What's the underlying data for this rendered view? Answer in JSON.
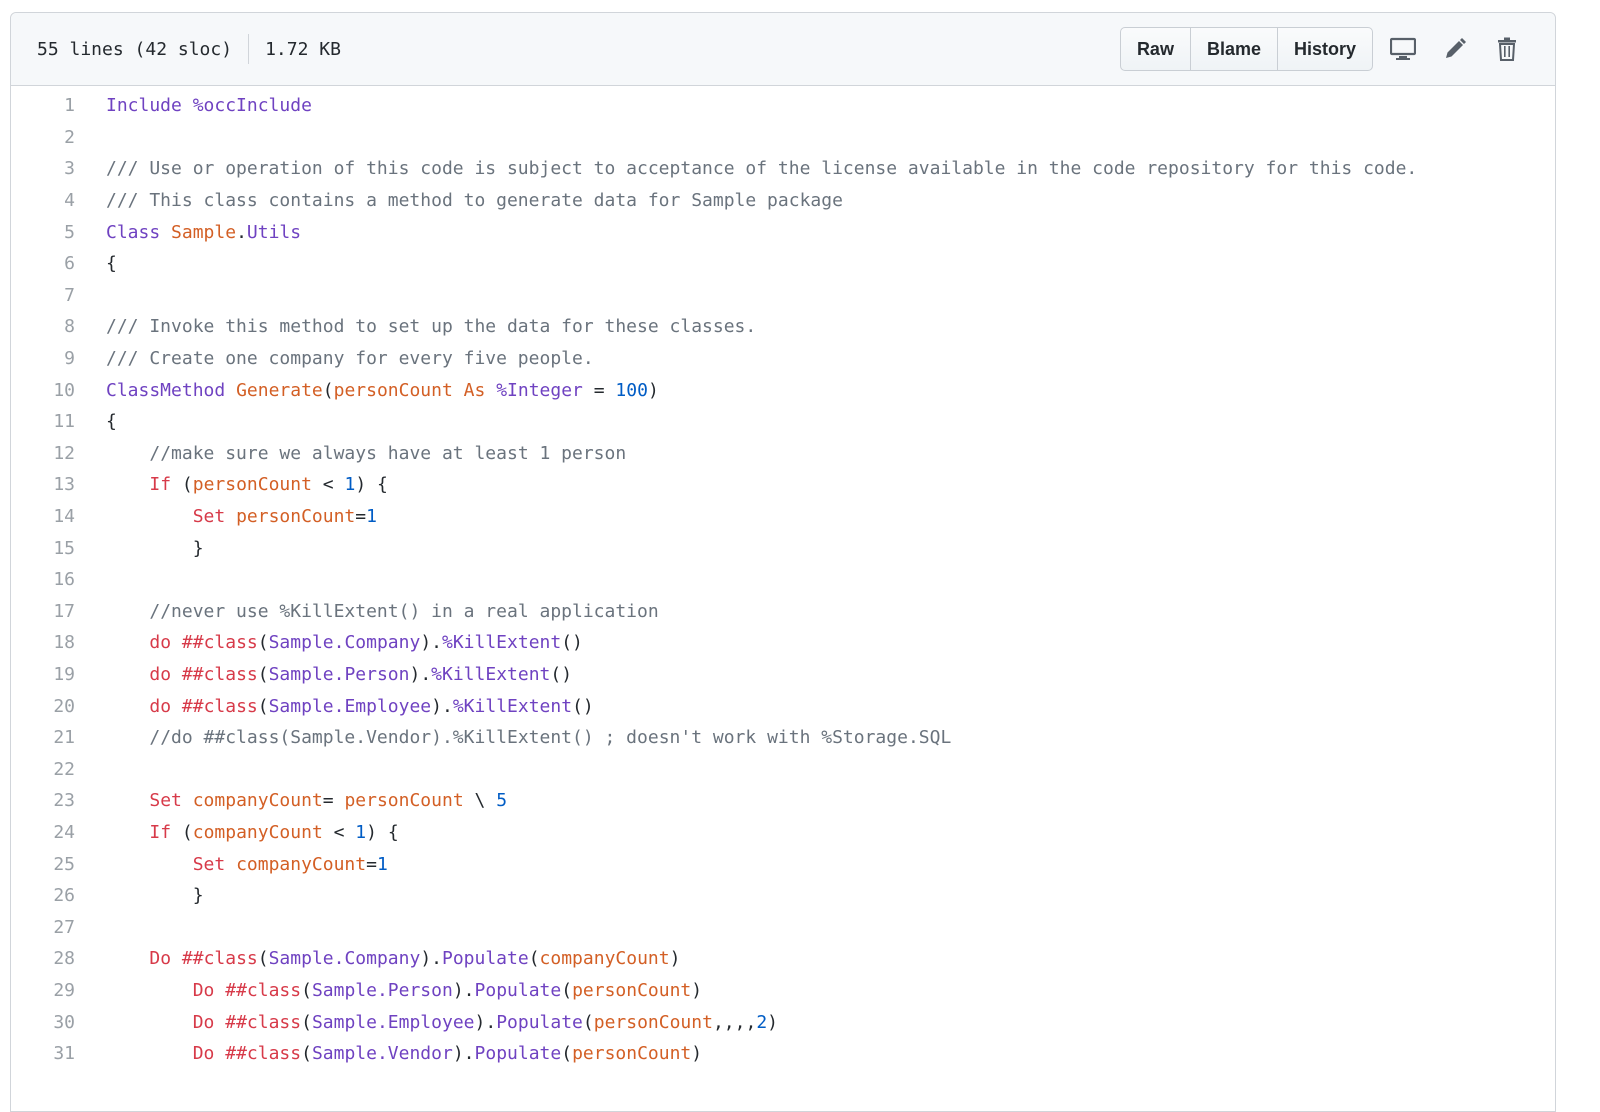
{
  "header": {
    "lines_info": "55 lines (42 sloc)",
    "size": "1.72 KB",
    "buttons": {
      "raw": "Raw",
      "blame": "Blame",
      "history": "History"
    },
    "icons": [
      "desktop-icon",
      "pencil-icon",
      "trash-icon"
    ]
  },
  "code": {
    "line_numbers": [
      "1",
      "2",
      "3",
      "4",
      "5",
      "6",
      "7",
      "8",
      "9",
      "10",
      "11",
      "12",
      "13",
      "14",
      "15",
      "16",
      "17",
      "18",
      "19",
      "20",
      "21",
      "22",
      "23",
      "24",
      "25",
      "26",
      "27",
      "28",
      "29",
      "30",
      "31"
    ],
    "l1": [
      "Include %occInclude"
    ],
    "l3": [
      "/// Use or operation of this code is subject to acceptance of the license available in the code repository for this code."
    ],
    "l4": [
      "/// This class contains a method to generate data for Sample package"
    ],
    "l5": [
      "Class",
      " ",
      "Sample",
      ".",
      "Utils"
    ],
    "l6": [
      "{"
    ],
    "l8": [
      "/// Invoke this method to set up the data for these classes."
    ],
    "l9": [
      "/// Create one company for every five people."
    ],
    "l10": [
      "ClassMethod",
      " ",
      "Generate",
      "(",
      "personCount",
      " ",
      "As",
      " ",
      "%Integer",
      " = ",
      "100",
      ")"
    ],
    "l11": [
      "{"
    ],
    "l12": [
      "    ",
      "//make sure we always have at least 1 person"
    ],
    "l13": [
      "    ",
      "If",
      " (",
      "personCount",
      " < ",
      "1",
      ") {"
    ],
    "l14": [
      "        ",
      "Set",
      " ",
      "personCount",
      "=",
      "1"
    ],
    "l15": [
      "        }"
    ],
    "l17": [
      "    ",
      "//never use %KillExtent() in a real application"
    ],
    "l18": [
      "    ",
      "do",
      " ",
      "##class",
      "(",
      "Sample.Company",
      ").",
      "%KillExtent",
      "()"
    ],
    "l19": [
      "    ",
      "do",
      " ",
      "##class",
      "(",
      "Sample.Person",
      ").",
      "%KillExtent",
      "()"
    ],
    "l20": [
      "    ",
      "do",
      " ",
      "##class",
      "(",
      "Sample.Employee",
      ").",
      "%KillExtent",
      "()"
    ],
    "l21": [
      "    ",
      "//do ##class(Sample.Vendor).%KillExtent() ; doesn't work with %Storage.SQL"
    ],
    "l23": [
      "    ",
      "Set",
      " ",
      "companyCount",
      "= ",
      "personCount",
      " \\ ",
      "5"
    ],
    "l24": [
      "    ",
      "If",
      " (",
      "companyCount",
      " < ",
      "1",
      ") {"
    ],
    "l25": [
      "        ",
      "Set",
      " ",
      "companyCount",
      "=",
      "1"
    ],
    "l26": [
      "        }"
    ],
    "l28": [
      "    ",
      "Do",
      " ",
      "##class",
      "(",
      "Sample.Company",
      ").",
      "Populate",
      "(",
      "companyCount",
      ")"
    ],
    "l29": [
      "        ",
      "Do",
      " ",
      "##class",
      "(",
      "Sample.Person",
      ").",
      "Populate",
      "(",
      "personCount",
      ")"
    ],
    "l30": [
      "        ",
      "Do",
      " ",
      "##class",
      "(",
      "Sample.Employee",
      ").",
      "Populate",
      "(",
      "personCount",
      ",,,,",
      "2",
      ")"
    ],
    "l31": [
      "        ",
      "Do",
      " ",
      "##class",
      "(",
      "Sample.Vendor",
      ").",
      "Populate",
      "(",
      "personCount",
      ")"
    ]
  },
  "colors": {
    "keyword": "#6f42c1",
    "comment": "#6a737d",
    "identifier": "#d35f25",
    "command": "#d73a49",
    "number": "#005cc5"
  }
}
